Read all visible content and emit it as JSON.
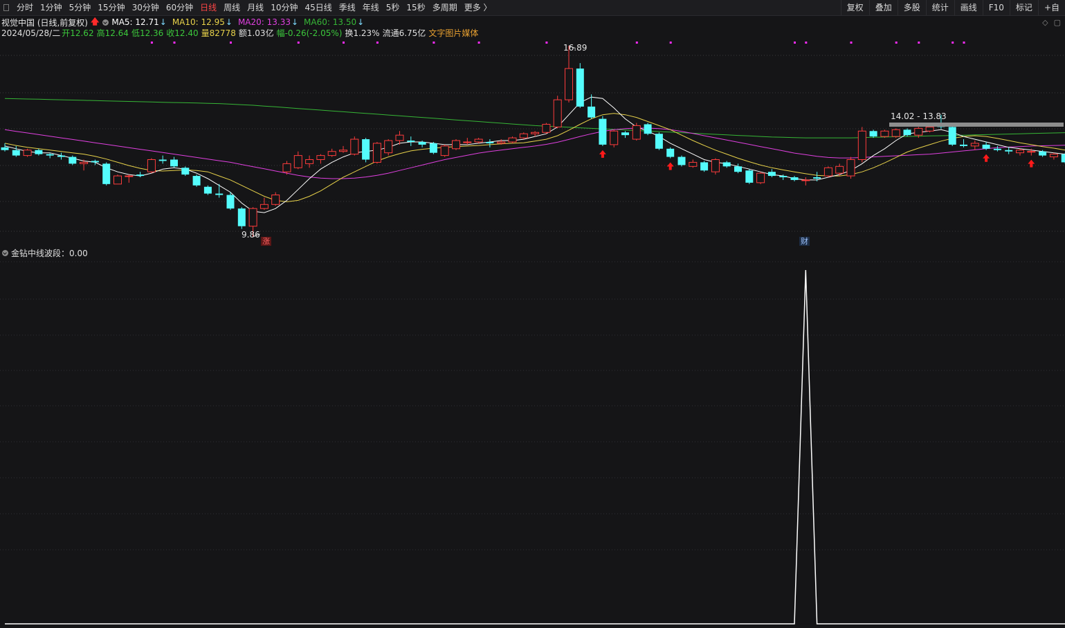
{
  "toolbar": {
    "periods": [
      "分时",
      "1分钟",
      "5分钟",
      "15分钟",
      "30分钟",
      "60分钟",
      "日线",
      "周线",
      "月线",
      "10分钟",
      "45日线",
      "季线",
      "年线",
      "5秒",
      "15秒",
      "多周期",
      "更多 〉"
    ],
    "active_period": "日线",
    "right_tools": [
      "复权",
      "叠加",
      "多股",
      "统计",
      "画线",
      "F10",
      "标记",
      "+自"
    ]
  },
  "info": {
    "title": "视觉中国 (日线,前复权)",
    "ma5": "MA5: 12.71",
    "ma10": "MA10: 12.95",
    "ma20": "MA20: 13.33",
    "ma60": "MA60: 13.50",
    "date": "2024/05/28/二",
    "open": "开12.62",
    "high": "高12.64",
    "low": "低12.36",
    "close": "收12.40",
    "volume": "量82778",
    "amount": "额1.03亿",
    "change": "幅-0.26(-2.05%)",
    "turnover": "换1.23%",
    "float": "流通6.75亿",
    "concept": "文字图片媒体"
  },
  "labels": {
    "high_price": "16.89",
    "low_price": "9.86",
    "range_tag": "14.02 - 13.83",
    "flag_zhang": "涨",
    "flag_cai": "财"
  },
  "sub_indicator": {
    "title": "金钻中线波段：0.00"
  },
  "colors": {
    "up": "#ff3c3c",
    "down": "#54fcfc",
    "ma5": "#ffffff",
    "ma10": "#e8d24a",
    "ma20": "#e040e0",
    "ma60": "#36b636",
    "active": "#ff4646",
    "signal": "#ff1a1a",
    "marker": "#ff2cff"
  },
  "chart_data": {
    "type": "candlestick",
    "price_range": [
      9.86,
      16.89
    ],
    "candles": [
      {
        "o": 13.15,
        "h": 13.3,
        "l": 13.0,
        "c": 13.05
      },
      {
        "o": 13.05,
        "h": 13.2,
        "l": 12.8,
        "c": 12.85
      },
      {
        "o": 12.85,
        "h": 13.1,
        "l": 12.8,
        "c": 13.05
      },
      {
        "o": 13.05,
        "h": 13.1,
        "l": 12.85,
        "c": 12.9
      },
      {
        "o": 12.9,
        "h": 12.95,
        "l": 12.75,
        "c": 12.85
      },
      {
        "o": 12.85,
        "h": 12.95,
        "l": 12.7,
        "c": 12.8
      },
      {
        "o": 12.8,
        "h": 12.85,
        "l": 12.5,
        "c": 12.55
      },
      {
        "o": 12.55,
        "h": 12.7,
        "l": 12.3,
        "c": 12.6
      },
      {
        "o": 12.65,
        "h": 12.7,
        "l": 12.5,
        "c": 12.6
      },
      {
        "o": 12.55,
        "h": 12.6,
        "l": 11.75,
        "c": 11.8
      },
      {
        "o": 11.8,
        "h": 12.15,
        "l": 11.8,
        "c": 12.1
      },
      {
        "o": 12.1,
        "h": 12.15,
        "l": 11.85,
        "c": 12.1
      },
      {
        "o": 12.15,
        "h": 12.25,
        "l": 12.05,
        "c": 12.1
      },
      {
        "o": 12.25,
        "h": 12.75,
        "l": 12.2,
        "c": 12.7
      },
      {
        "o": 12.7,
        "h": 12.85,
        "l": 12.55,
        "c": 12.65
      },
      {
        "o": 12.7,
        "h": 12.8,
        "l": 12.4,
        "c": 12.45
      },
      {
        "o": 12.4,
        "h": 12.45,
        "l": 12.1,
        "c": 12.15
      },
      {
        "o": 12.1,
        "h": 12.15,
        "l": 11.7,
        "c": 11.75
      },
      {
        "o": 11.7,
        "h": 11.75,
        "l": 11.4,
        "c": 11.45
      },
      {
        "o": 11.45,
        "h": 11.8,
        "l": 11.3,
        "c": 11.4
      },
      {
        "o": 11.4,
        "h": 11.5,
        "l": 10.85,
        "c": 10.9
      },
      {
        "o": 10.9,
        "h": 10.95,
        "l": 10.15,
        "c": 10.25
      },
      {
        "o": 10.25,
        "h": 10.95,
        "l": 9.86,
        "c": 10.9
      },
      {
        "o": 10.9,
        "h": 11.3,
        "l": 10.85,
        "c": 11.05
      },
      {
        "o": 11.05,
        "h": 11.5,
        "l": 11.0,
        "c": 11.4
      },
      {
        "o": 12.25,
        "h": 12.65,
        "l": 12.15,
        "c": 12.55
      },
      {
        "o": 12.4,
        "h": 13.0,
        "l": 12.35,
        "c": 12.85
      },
      {
        "o": 12.55,
        "h": 12.85,
        "l": 12.4,
        "c": 12.7
      },
      {
        "o": 12.7,
        "h": 12.9,
        "l": 12.55,
        "c": 12.85
      },
      {
        "o": 12.85,
        "h": 13.1,
        "l": 12.8,
        "c": 13.0
      },
      {
        "o": 13.0,
        "h": 13.2,
        "l": 12.95,
        "c": 13.05
      },
      {
        "o": 12.9,
        "h": 13.55,
        "l": 12.85,
        "c": 13.45
      },
      {
        "o": 13.45,
        "h": 13.5,
        "l": 12.6,
        "c": 12.7
      },
      {
        "o": 12.6,
        "h": 13.35,
        "l": 12.55,
        "c": 13.3
      },
      {
        "o": 12.95,
        "h": 13.45,
        "l": 12.85,
        "c": 13.4
      },
      {
        "o": 13.4,
        "h": 13.75,
        "l": 13.25,
        "c": 13.6
      },
      {
        "o": 13.4,
        "h": 13.55,
        "l": 13.2,
        "c": 13.35
      },
      {
        "o": 13.35,
        "h": 13.4,
        "l": 13.15,
        "c": 13.25
      },
      {
        "o": 13.3,
        "h": 13.35,
        "l": 12.9,
        "c": 12.95
      },
      {
        "o": 12.85,
        "h": 13.25,
        "l": 12.8,
        "c": 13.2
      },
      {
        "o": 13.1,
        "h": 13.45,
        "l": 13.05,
        "c": 13.4
      },
      {
        "o": 13.35,
        "h": 13.5,
        "l": 13.25,
        "c": 13.35
      },
      {
        "o": 13.35,
        "h": 13.5,
        "l": 13.3,
        "c": 13.45
      },
      {
        "o": 13.35,
        "h": 13.45,
        "l": 13.15,
        "c": 13.3
      },
      {
        "o": 13.3,
        "h": 13.45,
        "l": 13.25,
        "c": 13.35
      },
      {
        "o": 13.35,
        "h": 13.55,
        "l": 13.3,
        "c": 13.5
      },
      {
        "o": 13.5,
        "h": 13.7,
        "l": 13.45,
        "c": 13.65
      },
      {
        "o": 13.65,
        "h": 13.75,
        "l": 13.55,
        "c": 13.7
      },
      {
        "o": 13.7,
        "h": 14.05,
        "l": 13.65,
        "c": 14.0
      },
      {
        "o": 13.9,
        "h": 15.05,
        "l": 13.85,
        "c": 14.9
      },
      {
        "o": 14.9,
        "h": 16.89,
        "l": 14.8,
        "c": 16.05
      },
      {
        "o": 16.05,
        "h": 16.25,
        "l": 14.6,
        "c": 14.65
      },
      {
        "o": 14.65,
        "h": 15.1,
        "l": 14.2,
        "c": 14.25
      },
      {
        "o": 14.2,
        "h": 14.3,
        "l": 13.2,
        "c": 13.25
      },
      {
        "o": 13.25,
        "h": 13.8,
        "l": 13.15,
        "c": 13.75
      },
      {
        "o": 13.7,
        "h": 13.75,
        "l": 13.5,
        "c": 13.6
      },
      {
        "o": 13.45,
        "h": 14.05,
        "l": 13.4,
        "c": 13.95
      },
      {
        "o": 14.0,
        "h": 14.05,
        "l": 13.6,
        "c": 13.65
      },
      {
        "o": 13.65,
        "h": 13.7,
        "l": 13.05,
        "c": 13.1
      },
      {
        "o": 13.1,
        "h": 13.15,
        "l": 12.75,
        "c": 12.8
      },
      {
        "o": 12.8,
        "h": 12.85,
        "l": 12.45,
        "c": 12.5
      },
      {
        "o": 12.45,
        "h": 12.7,
        "l": 12.4,
        "c": 12.6
      },
      {
        "o": 12.6,
        "h": 12.65,
        "l": 12.25,
        "c": 12.3
      },
      {
        "o": 12.25,
        "h": 12.75,
        "l": 12.15,
        "c": 12.7
      },
      {
        "o": 12.6,
        "h": 12.65,
        "l": 12.4,
        "c": 12.45
      },
      {
        "o": 12.45,
        "h": 12.55,
        "l": 12.2,
        "c": 12.25
      },
      {
        "o": 12.3,
        "h": 12.35,
        "l": 11.8,
        "c": 11.85
      },
      {
        "o": 11.85,
        "h": 12.25,
        "l": 11.8,
        "c": 12.2
      },
      {
        "o": 12.25,
        "h": 12.35,
        "l": 12.05,
        "c": 12.1
      },
      {
        "o": 12.1,
        "h": 12.15,
        "l": 11.95,
        "c": 12.05
      },
      {
        "o": 12.05,
        "h": 12.1,
        "l": 11.9,
        "c": 11.95
      },
      {
        "o": 11.95,
        "h": 12.05,
        "l": 11.75,
        "c": 11.95
      },
      {
        "o": 12.05,
        "h": 12.25,
        "l": 11.9,
        "c": 12.0
      },
      {
        "o": 12.1,
        "h": 12.45,
        "l": 12.05,
        "c": 12.4
      },
      {
        "o": 12.2,
        "h": 12.55,
        "l": 12.1,
        "c": 12.45
      },
      {
        "o": 12.1,
        "h": 12.8,
        "l": 12.0,
        "c": 12.7
      },
      {
        "o": 12.7,
        "h": 13.9,
        "l": 12.6,
        "c": 13.75
      },
      {
        "o": 13.75,
        "h": 13.8,
        "l": 13.5,
        "c": 13.55
      },
      {
        "o": 13.55,
        "h": 13.8,
        "l": 13.5,
        "c": 13.75
      },
      {
        "o": 13.55,
        "h": 13.85,
        "l": 13.5,
        "c": 13.8
      },
      {
        "o": 13.8,
        "h": 13.85,
        "l": 13.55,
        "c": 13.6
      },
      {
        "o": 13.6,
        "h": 13.9,
        "l": 13.5,
        "c": 13.85
      },
      {
        "o": 13.75,
        "h": 14.05,
        "l": 13.7,
        "c": 13.9
      },
      {
        "o": 14.02,
        "h": 14.35,
        "l": 13.83,
        "c": 13.9
      },
      {
        "o": 13.9,
        "h": 13.95,
        "l": 13.2,
        "c": 13.25
      },
      {
        "o": 13.25,
        "h": 13.45,
        "l": 13.15,
        "c": 13.2
      },
      {
        "o": 13.2,
        "h": 13.4,
        "l": 13.05,
        "c": 13.3
      },
      {
        "o": 13.25,
        "h": 13.35,
        "l": 13.05,
        "c": 13.1
      },
      {
        "o": 13.1,
        "h": 13.2,
        "l": 13.0,
        "c": 13.05
      },
      {
        "o": 13.05,
        "h": 13.15,
        "l": 12.9,
        "c": 13.0
      },
      {
        "o": 12.95,
        "h": 13.1,
        "l": 12.85,
        "c": 13.05
      },
      {
        "o": 13.0,
        "h": 13.1,
        "l": 12.85,
        "c": 13.0
      },
      {
        "o": 13.0,
        "h": 13.05,
        "l": 12.8,
        "c": 12.85
      },
      {
        "o": 12.8,
        "h": 12.95,
        "l": 12.7,
        "c": 12.9
      },
      {
        "o": 12.9,
        "h": 12.95,
        "l": 12.55,
        "c": 12.6
      },
      {
        "o": 12.6,
        "h": 12.65,
        "l": 12.4,
        "c": 12.45
      },
      {
        "o": 12.45,
        "h": 12.6,
        "l": 12.3,
        "c": 12.5
      },
      {
        "o": 12.62,
        "h": 12.64,
        "l": 12.36,
        "c": 12.4
      }
    ],
    "ma5": [
      13.2,
      13.1,
      13.0,
      12.95,
      12.95,
      12.85,
      12.75,
      12.65,
      12.6,
      12.4,
      12.25,
      12.15,
      12.1,
      12.2,
      12.35,
      12.4,
      12.35,
      12.2,
      12.0,
      11.75,
      11.5,
      11.1,
      10.8,
      10.75,
      10.9,
      11.2,
      11.6,
      12.0,
      12.35,
      12.6,
      12.8,
      12.95,
      13.0,
      13.05,
      13.15,
      13.3,
      13.35,
      13.35,
      13.3,
      13.25,
      13.25,
      13.25,
      13.3,
      13.35,
      13.4,
      13.4,
      13.45,
      13.55,
      13.65,
      13.9,
      14.35,
      14.8,
      15.0,
      14.95,
      14.6,
      14.2,
      13.9,
      13.75,
      13.55,
      13.3,
      13.1,
      12.9,
      12.7,
      12.6,
      12.55,
      12.45,
      12.35,
      12.25,
      12.15,
      12.1,
      12.0,
      11.95,
      11.95,
      12.05,
      12.15,
      12.3,
      12.55,
      12.85,
      13.1,
      13.4,
      13.65,
      13.7,
      13.75,
      13.8,
      13.7,
      13.55,
      13.45,
      13.35,
      13.25,
      13.15,
      13.1,
      13.05,
      13.0,
      12.95,
      12.9,
      12.8,
      12.7,
      12.6,
      12.5,
      12.45
    ],
    "ma10": [
      13.3,
      13.22,
      13.15,
      13.1,
      13.05,
      13.0,
      12.95,
      12.9,
      12.82,
      12.72,
      12.6,
      12.48,
      12.38,
      12.3,
      12.28,
      12.3,
      12.32,
      12.3,
      12.25,
      12.1,
      11.95,
      11.75,
      11.55,
      11.35,
      11.2,
      11.15,
      11.2,
      11.35,
      11.55,
      11.8,
      12.05,
      12.25,
      12.45,
      12.65,
      12.8,
      12.92,
      13.02,
      13.08,
      13.12,
      13.15,
      13.18,
      13.2,
      13.22,
      13.25,
      13.28,
      13.3,
      13.32,
      13.38,
      13.45,
      13.58,
      13.78,
      14.0,
      14.2,
      14.35,
      14.4,
      14.35,
      14.25,
      14.1,
      13.95,
      13.8,
      13.6,
      13.4,
      13.22,
      13.05,
      12.9,
      12.75,
      12.62,
      12.5,
      12.4,
      12.32,
      12.25,
      12.18,
      12.12,
      12.1,
      12.1,
      12.15,
      12.25,
      12.4,
      12.58,
      12.78,
      12.98,
      13.12,
      13.25,
      13.38,
      13.48,
      13.55,
      13.58,
      13.55,
      13.48,
      13.4,
      13.32,
      13.25,
      13.18,
      13.12,
      13.05,
      12.98,
      12.9,
      12.85,
      12.8,
      12.75
    ],
    "ma20": [
      13.8,
      13.74,
      13.68,
      13.62,
      13.56,
      13.5,
      13.44,
      13.38,
      13.32,
      13.26,
      13.2,
      13.14,
      13.08,
      13.02,
      12.96,
      12.9,
      12.84,
      12.78,
      12.72,
      12.66,
      12.6,
      12.52,
      12.44,
      12.36,
      12.28,
      12.2,
      12.12,
      12.06,
      12.02,
      12.0,
      12.0,
      12.02,
      12.06,
      12.12,
      12.2,
      12.3,
      12.4,
      12.5,
      12.6,
      12.7,
      12.78,
      12.86,
      12.94,
      13.0,
      13.05,
      13.1,
      13.15,
      13.2,
      13.26,
      13.34,
      13.44,
      13.55,
      13.65,
      13.74,
      13.8,
      13.84,
      13.86,
      13.86,
      13.84,
      13.8,
      13.74,
      13.66,
      13.58,
      13.5,
      13.42,
      13.34,
      13.26,
      13.18,
      13.1,
      13.02,
      12.94,
      12.88,
      12.82,
      12.78,
      12.76,
      12.76,
      12.78,
      12.8,
      12.82,
      12.84,
      12.86,
      12.88,
      12.9,
      12.94,
      12.98,
      13.02,
      13.06,
      13.1,
      13.14,
      13.16,
      13.18,
      13.2,
      13.21,
      13.22,
      13.23,
      13.24,
      13.25,
      13.26,
      13.28,
      13.3
    ],
    "ma60": [
      14.95,
      14.94,
      14.93,
      14.92,
      14.91,
      14.9,
      14.89,
      14.88,
      14.87,
      14.86,
      14.85,
      14.84,
      14.83,
      14.82,
      14.81,
      14.8,
      14.79,
      14.78,
      14.77,
      14.76,
      14.74,
      14.72,
      14.7,
      14.67,
      14.64,
      14.61,
      14.58,
      14.55,
      14.52,
      14.49,
      14.46,
      14.43,
      14.4,
      14.37,
      14.34,
      14.31,
      14.28,
      14.25,
      14.22,
      14.19,
      14.16,
      14.13,
      14.1,
      14.07,
      14.04,
      14.01,
      13.98,
      13.95,
      13.93,
      13.91,
      13.89,
      13.87,
      13.85,
      13.83,
      13.81,
      13.79,
      13.77,
      13.75,
      13.73,
      13.71,
      13.69,
      13.67,
      13.65,
      13.63,
      13.61,
      13.59,
      13.57,
      13.55,
      13.53,
      13.52,
      13.51,
      13.5,
      13.5,
      13.5,
      13.5,
      13.5,
      13.51,
      13.52,
      13.53,
      13.54,
      13.55,
      13.56,
      13.57,
      13.58,
      13.59,
      13.6,
      13.61,
      13.62,
      13.63,
      13.64,
      13.65,
      13.66,
      13.67,
      13.68,
      13.69,
      13.7,
      13.7,
      13.7,
      13.7,
      13.7
    ],
    "up_signal_indices": [
      53,
      59,
      87,
      91
    ],
    "marker_indices": [
      13,
      15,
      20,
      26,
      30,
      33,
      38,
      42,
      48,
      56,
      59,
      70,
      71,
      75,
      79,
      81,
      84,
      85
    ],
    "sub_indicator_spike_index": 71,
    "sub_indicator_baseline": 0,
    "sub_indicator_peak": 1
  }
}
